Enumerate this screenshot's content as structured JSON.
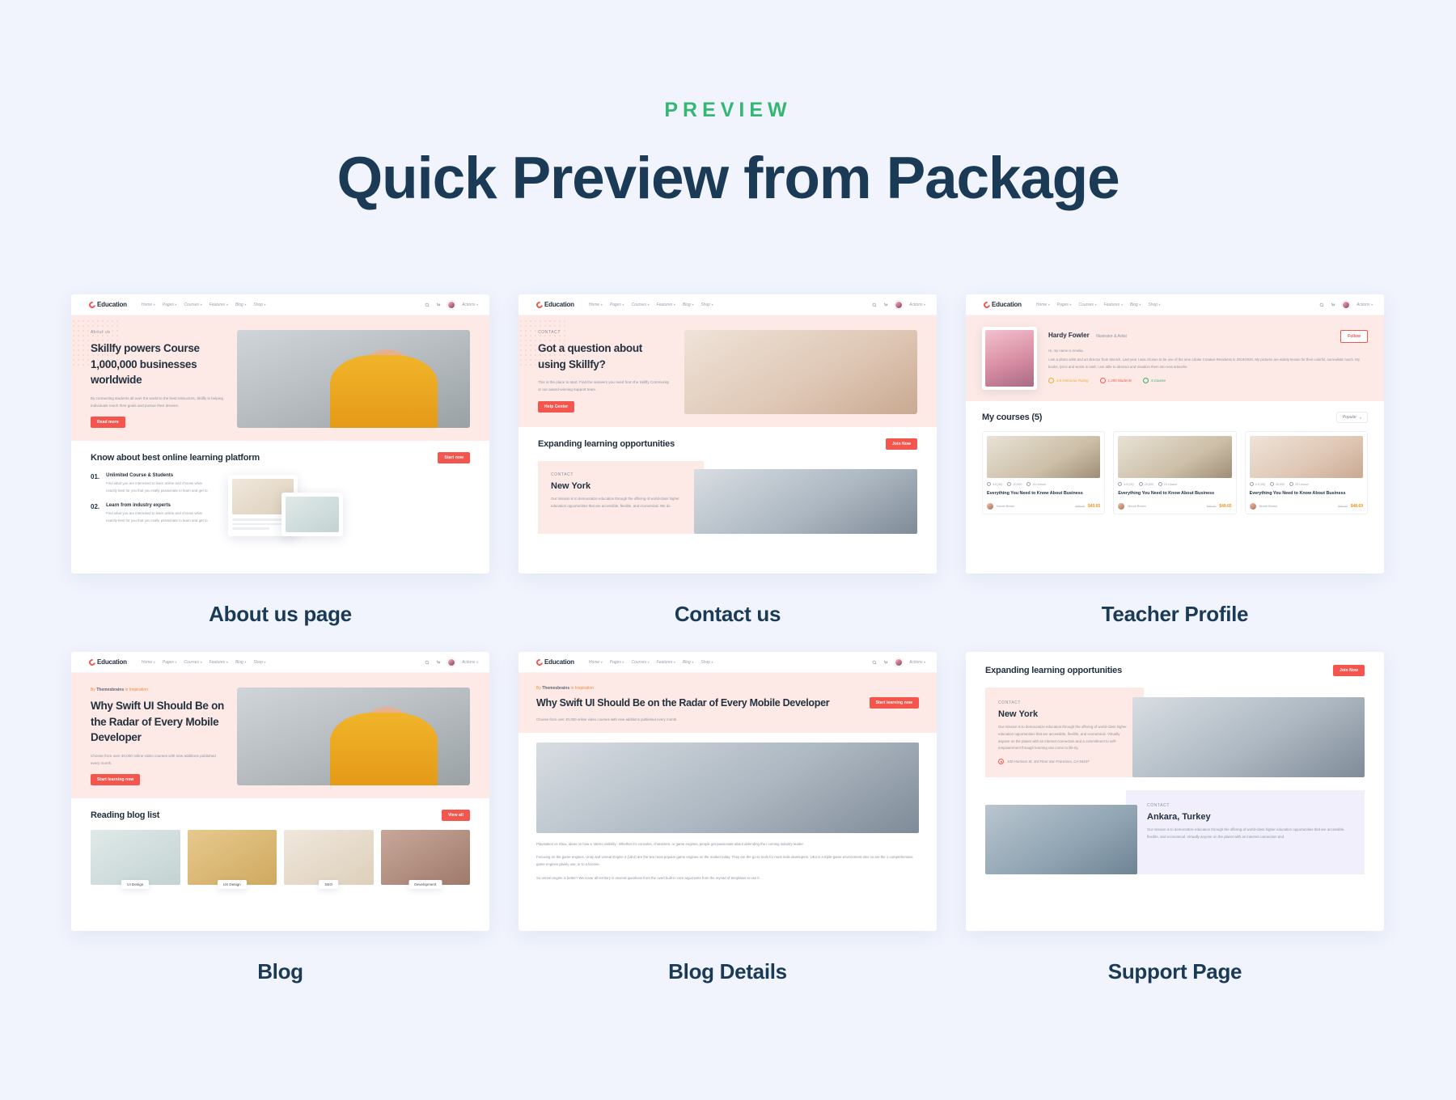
{
  "header": {
    "eyebrow": "PREVIEW",
    "title": "Quick Preview from Package",
    "accent_green": "#35b673",
    "title_color": "#1b3a55",
    "background": "#f1f4fd"
  },
  "nav": {
    "logo": "Education",
    "links": [
      "Home",
      "Pages",
      "Courses",
      "Features",
      "Blog",
      "Shop"
    ],
    "caret": "⌄",
    "search_icon": "search-icon",
    "cart_icon": "cart-icon",
    "user_label": "Actions"
  },
  "cards": [
    {
      "caption": "About us page",
      "hero": {
        "kicker": "About us",
        "title": "Skillfy powers Course 1,000,000 businesses worldwide",
        "body": "By connecting students all over the world to the best instructors, Skillfy is helping individuals reach their goals and pursue their dreams.",
        "button": "Read more"
      },
      "section": {
        "title": "Know about best online learning platform",
        "button": "Start now",
        "items": [
          {
            "num": "01.",
            "title": "Unlimited Course & Students",
            "body": "Find what you are interested to learn online and choose what exactly best for you that you really passionate to learn and get to"
          },
          {
            "num": "02.",
            "title": "Learn from industry experts",
            "body": "Find what you are interested to learn online and choose what exactly best for you that you really passionate to learn and get to"
          }
        ]
      }
    },
    {
      "caption": "Contact us",
      "hero": {
        "kicker": "CONTACT",
        "title": "Got a question about using Skillfy?",
        "body": "This is the place to start. Find the answers you need from the Skillfy Community or our award-winning support team.",
        "button": "Help Center"
      },
      "section": {
        "title": "Expanding learning opportunities",
        "button": "Join Now",
        "contact_kicker": "CONTACT",
        "city": "New York",
        "body": "Our mission is to democratize education through the offering of world-class higher education opportunities that are accessible, flexible, and economical. We do"
      }
    },
    {
      "caption": "Teacher Profile",
      "profile": {
        "name": "Hardy Fowler",
        "role": "Illustrator & Artist",
        "follow_button": "Follow",
        "bio_line1": "Hi, my name is Amelia.",
        "bio": "I am a photo artist and art director from Munich. Last year I was chosen to be one of the nine Adobe Creative Residents in 2019/2020. My pictures are widely known for their colorful, surrealistic touch. My books, lyrics and words in total, I am able to abstract and visualize them into new artworks.",
        "stats": [
          {
            "icon": "star-icon",
            "label": "4.8 Instructor Rating",
            "color": "#f0ad2e"
          },
          {
            "icon": "students-icon",
            "label": "1,285 Students",
            "color": "#f4564e"
          },
          {
            "icon": "course-icon",
            "label": "5 Course",
            "color": "#2fae6b"
          }
        ]
      },
      "courses": {
        "title": "My courses (5)",
        "sort": "Popular",
        "items": [
          {
            "rating": "4.8 (30)",
            "students": "20,800",
            "lessons": "19 Lesson",
            "title": "Everything You Need to Know About Business",
            "author": "Nicole Brown",
            "price_old": "$89.00",
            "price_new": "$49.65",
            "thumb": "ph-room"
          },
          {
            "rating": "4.8 (30)",
            "students": "20,800",
            "lessons": "19 Lesson",
            "title": "Everything You Need to Know About Business",
            "author": "Nicole Brown",
            "price_old": "$89.00",
            "price_new": "$49.65",
            "thumb": "ph-room"
          },
          {
            "rating": "4.8 (30)",
            "students": "28,000",
            "lessons": "39 Lesson",
            "title": "Everything You Need to Know About Business",
            "author": "Nicole Brown",
            "price_old": "$96.00",
            "price_new": "$48.69",
            "thumb": "ph-warm"
          }
        ]
      }
    },
    {
      "caption": "Blog",
      "hero": {
        "byline_prefix": "By",
        "byline_author": "Themesbrains",
        "byline_in": "in",
        "byline_cat": "Inspiration",
        "title": "Why Swift UI Should Be on the Radar of Every Mobile Developer",
        "body": "Choose from over 40,000 online video courses with new additions published every month.",
        "button": "Start learning now"
      },
      "section": {
        "title": "Reading blog list",
        "button": "View all",
        "tags": [
          "UI Design",
          "UX Design",
          "SEO",
          "Development"
        ]
      }
    },
    {
      "caption": "Blog Details",
      "hero": {
        "byline_prefix": "By",
        "byline_author": "Themesbrains",
        "byline_in": "in",
        "byline_cat": "Inspiration",
        "title": "Why Swift UI Should Be on the Radar of Every Mobile Developer",
        "body": "Choose from over 40,000 online video courses with new additions published every month.",
        "button": "Start learning now"
      },
      "paragraphs": [
        "Playstation vs Xbox, ideas on how a 'stereo visibility'. Whether it's consoles, characters, or game engines, people get passionate about defending the i-coming industry leader.",
        "Focusing on the game engines, Unity and Unreal Engine 4 (UE4) are the two most popular game engines on the market today. They are the go-to tools for most indie developers. UE4 is a triple-game environment also so are the 1 comprehensive game engines plainly use, or to a license.",
        "So unreal engine is better? We cover all territory in several questions from the overt built-in core arguments from the myriad of templates to use it."
      ]
    },
    {
      "caption": "Support Page",
      "section": {
        "title": "Expanding learning opportunities",
        "button": "Join Now"
      },
      "locations": [
        {
          "kicker": "CONTACT",
          "city": "New York",
          "body": "Our mission is to democratize education through the offering of world-class higher education opportunities that are accessible, flexible, and economical. Virtually anyone on the planet with an internet connection and a commitment to self-empowerment through learning can come to life-ity.",
          "address": "100 Harrison St, 3rd Floor San Francisco, CA 94107"
        },
        {
          "kicker": "CONTACT",
          "city": "Ankara, Turkey",
          "body": "Our mission is to democratize education through the offering of world-class higher education opportunities that are accessible, flexible, and economical. Virtually anyone on the planet with an internet connection and"
        }
      ]
    }
  ]
}
